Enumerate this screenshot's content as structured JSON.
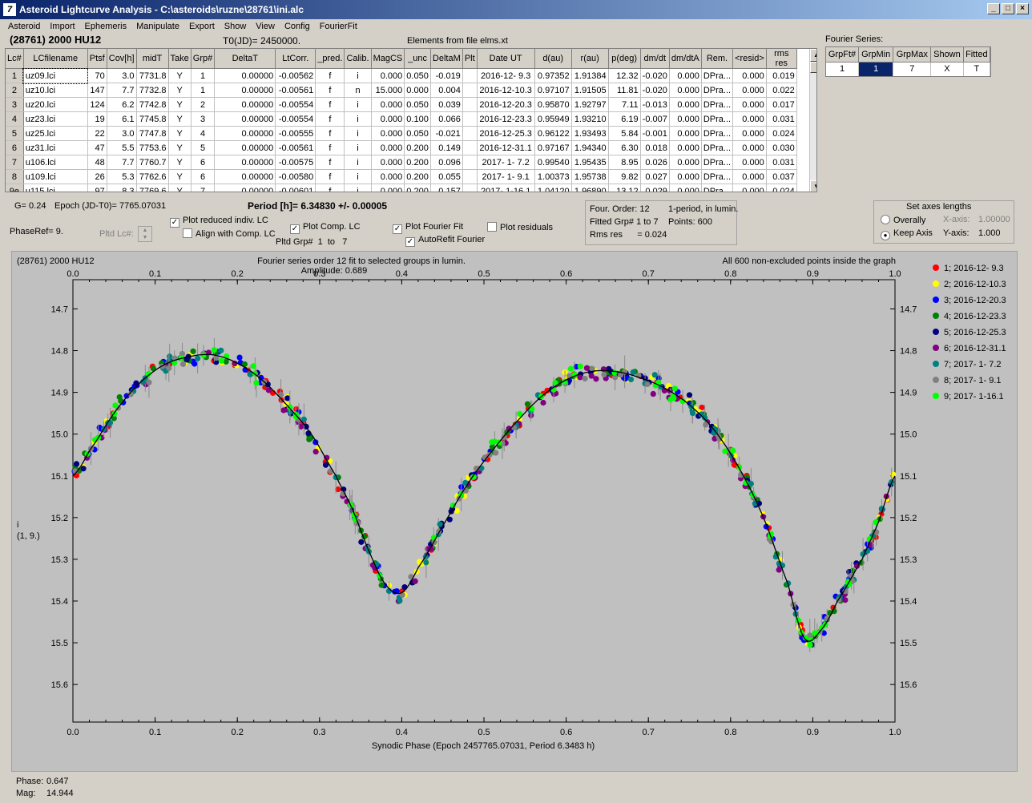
{
  "window": {
    "title": "Asteroid Lightcurve Analysis - C:\\asteroids\\ruzne\\28761\\ini.alc",
    "icon": "app-icon"
  },
  "menu": [
    "Asteroid",
    "Import",
    "Ephemeris",
    "Manipulate",
    "Export",
    "Show",
    "View",
    "Config",
    "FourierFit"
  ],
  "header": {
    "object": "(28761) 2000 HU12",
    "t0": "T0(JD)= 2450000.",
    "elements": "Elements from file elms.xt",
    "fourier_label": "Fourier Series:"
  },
  "table": {
    "columns": [
      "Lc#",
      "LCfilename",
      "Ptsf",
      "Cov[h]",
      "midT",
      "Take",
      "Grp#",
      "DeltaT",
      "LtCorr.",
      "_pred.",
      "Calib.",
      "MagCS",
      "_unc",
      "DeltaM",
      "Plt",
      "Date UT",
      "d(au)",
      "r(au)",
      "p(deg)",
      "dm/dt",
      "dm/dtA",
      "Rem.",
      "<resid>",
      "rms res"
    ],
    "rows": [
      [
        "1",
        "uz09.lci",
        "70",
        "3.0",
        "7731.8",
        "Y",
        "1",
        "0.00000",
        "-0.00562",
        "f",
        "i",
        "0.000",
        "0.050",
        "-0.019",
        "",
        "2016-12- 9.3",
        "0.97352",
        "1.91384",
        "12.32",
        "-0.020",
        "0.000",
        "DPra...",
        "0.000",
        "0.019"
      ],
      [
        "2",
        "uz10.lci",
        "147",
        "7.7",
        "7732.8",
        "Y",
        "1",
        "0.00000",
        "-0.00561",
        "f",
        "n",
        "15.000",
        "0.000",
        "0.004",
        "",
        "2016-12-10.3",
        "0.97107",
        "1.91505",
        "11.81",
        "-0.020",
        "0.000",
        "DPra...",
        "0.000",
        "0.022"
      ],
      [
        "3",
        "uz20.lci",
        "124",
        "6.2",
        "7742.8",
        "Y",
        "2",
        "0.00000",
        "-0.00554",
        "f",
        "i",
        "0.000",
        "0.050",
        "0.039",
        "",
        "2016-12-20.3",
        "0.95870",
        "1.92797",
        "7.11",
        "-0.013",
        "0.000",
        "DPra...",
        "0.000",
        "0.017"
      ],
      [
        "4",
        "uz23.lci",
        "19",
        "6.1",
        "7745.8",
        "Y",
        "3",
        "0.00000",
        "-0.00554",
        "f",
        "i",
        "0.000",
        "0.100",
        "0.066",
        "",
        "2016-12-23.3",
        "0.95949",
        "1.93210",
        "6.19",
        "-0.007",
        "0.000",
        "DPra...",
        "0.000",
        "0.031"
      ],
      [
        "5",
        "uz25.lci",
        "22",
        "3.0",
        "7747.8",
        "Y",
        "4",
        "0.00000",
        "-0.00555",
        "f",
        "i",
        "0.000",
        "0.050",
        "-0.021",
        "",
        "2016-12-25.3",
        "0.96122",
        "1.93493",
        "5.84",
        "-0.001",
        "0.000",
        "DPra...",
        "0.000",
        "0.024"
      ],
      [
        "6",
        "uz31.lci",
        "47",
        "5.5",
        "7753.6",
        "Y",
        "5",
        "0.00000",
        "-0.00561",
        "f",
        "i",
        "0.000",
        "0.200",
        "0.149",
        "",
        "2016-12-31.1",
        "0.97167",
        "1.94340",
        "6.30",
        "0.018",
        "0.000",
        "DPra...",
        "0.000",
        "0.030"
      ],
      [
        "7",
        "u106.lci",
        "48",
        "7.7",
        "7760.7",
        "Y",
        "6",
        "0.00000",
        "-0.00575",
        "f",
        "i",
        "0.000",
        "0.200",
        "0.096",
        "",
        "2017- 1- 7.2",
        "0.99540",
        "1.95435",
        "8.95",
        "0.026",
        "0.000",
        "DPra...",
        "0.000",
        "0.031"
      ],
      [
        "8",
        "u109.lci",
        "26",
        "5.3",
        "7762.6",
        "Y",
        "6",
        "0.00000",
        "-0.00580",
        "f",
        "i",
        "0.000",
        "0.200",
        "0.055",
        "",
        "2017- 1- 9.1",
        "1.00373",
        "1.95738",
        "9.82",
        "0.027",
        "0.000",
        "DPra...",
        "0.000",
        "0.037"
      ],
      [
        "9e",
        "u115.lci",
        "97",
        "8.3",
        "7769.6",
        "Y",
        "7",
        "0.00000",
        "-0.00601",
        "f",
        "i",
        "0.000",
        "0.200",
        "0.157",
        "",
        "2017- 1-16.1",
        "1.04120",
        "1.96890",
        "13.12",
        "0.029",
        "0.000",
        "DPra...",
        "0.000",
        "0.024"
      ]
    ]
  },
  "fourier_table": {
    "columns": [
      "GrpFt#",
      "GrpMin",
      "GrpMax",
      "Shown",
      "Fitted"
    ],
    "row": [
      "1",
      "1",
      "7",
      "X",
      "T"
    ]
  },
  "info": {
    "g": "G= 0.24",
    "epoch": "Epoch (JD-T0)= 7765.07031",
    "period": "Period [h]= 6.34830 +/- 0.00005",
    "phaseref": "PhaseRef= 9.",
    "pltd_lc": "Pltd Lc#:",
    "pltd_grp": "Pltd Grp#",
    "grp_from": "1",
    "grp_to_word": "to",
    "grp_to": "7"
  },
  "checks": {
    "plot_reduced": "Plot reduced indiv. LC",
    "align": "Align with Comp. LC",
    "plot_comp": "Plot Comp. LC",
    "plot_fourier": "Plot Fourier Fit",
    "autorefit": "AutoRefit Fourier",
    "plot_resid": "Plot residuals"
  },
  "fourier_info": {
    "order": "Four. Order: 12",
    "mode": "1-period, in lumin.",
    "fitted": "Fitted Grp# 1 to 7",
    "points": "Points: 600",
    "rms": "Rms res      = 0.024"
  },
  "axes": {
    "title": "Set axes lengths",
    "overally": "Overally",
    "keep": "Keep Axis",
    "xaxis_label": "X-axis:",
    "xaxis_val": "1.00000",
    "yaxis_label": "Y-axis:",
    "yaxis_val": "1.000"
  },
  "status": {
    "phase_label": "Phase:",
    "phase": "0.647",
    "mag_label": "Mag:",
    "mag": "14.944"
  },
  "chart_data": {
    "type": "scatter",
    "title_left": "(28761) 2000 HU12",
    "title_center": "Fourier series order 12 fit to selected groups in lumin.",
    "amplitude": "Amplitude: 0.689",
    "title_right": "All 600 non-excluded points inside the graph",
    "xlabel": "Synodic Phase (Epoch 2457765.07031, Period 6.3483 h)",
    "ylabel": [
      "i",
      "(1, 9.)"
    ],
    "xlim": [
      0,
      1
    ],
    "ylim": [
      14.63,
      15.69
    ],
    "y_inverted": true,
    "xticks": [
      "0.0",
      "0.1",
      "0.2",
      "0.3",
      "0.4",
      "0.5",
      "0.6",
      "0.7",
      "0.8",
      "0.9",
      "1.0"
    ],
    "yticks": [
      "14.7",
      "14.8",
      "14.9",
      "15.0",
      "15.1",
      "15.2",
      "15.3",
      "15.4",
      "15.5",
      "15.6"
    ],
    "fit_curve": [
      [
        0.0,
        15.1
      ],
      [
        0.02,
        15.04
      ],
      [
        0.05,
        14.95
      ],
      [
        0.08,
        14.88
      ],
      [
        0.11,
        14.835
      ],
      [
        0.14,
        14.815
      ],
      [
        0.17,
        14.81
      ],
      [
        0.2,
        14.83
      ],
      [
        0.23,
        14.87
      ],
      [
        0.26,
        14.93
      ],
      [
        0.29,
        15.0
      ],
      [
        0.32,
        15.1
      ],
      [
        0.34,
        15.18
      ],
      [
        0.36,
        15.28
      ],
      [
        0.38,
        15.36
      ],
      [
        0.4,
        15.38
      ],
      [
        0.42,
        15.32
      ],
      [
        0.45,
        15.22
      ],
      [
        0.48,
        15.12
      ],
      [
        0.51,
        15.04
      ],
      [
        0.54,
        14.97
      ],
      [
        0.57,
        14.91
      ],
      [
        0.6,
        14.87
      ],
      [
        0.63,
        14.85
      ],
      [
        0.66,
        14.85
      ],
      [
        0.69,
        14.865
      ],
      [
        0.72,
        14.89
      ],
      [
        0.75,
        14.93
      ],
      [
        0.78,
        14.99
      ],
      [
        0.81,
        15.08
      ],
      [
        0.84,
        15.2
      ],
      [
        0.87,
        15.36
      ],
      [
        0.89,
        15.49
      ],
      [
        0.91,
        15.47
      ],
      [
        0.93,
        15.4
      ],
      [
        0.96,
        15.3
      ],
      [
        0.98,
        15.21
      ],
      [
        1.0,
        15.1
      ]
    ],
    "series": [
      {
        "name": "1; 2016-12- 9.3",
        "color": "#ff0000"
      },
      {
        "name": "2; 2016-12-10.3",
        "color": "#ffff00"
      },
      {
        "name": "3; 2016-12-20.3",
        "color": "#0000ff"
      },
      {
        "name": "4; 2016-12-23.3",
        "color": "#008000"
      },
      {
        "name": "5; 2016-12-25.3",
        "color": "#000080"
      },
      {
        "name": "6; 2016-12-31.1",
        "color": "#800080"
      },
      {
        "name": "7; 2017- 1- 7.2",
        "color": "#008080"
      },
      {
        "name": "8; 2017- 1- 9.1",
        "color": "#808080"
      },
      {
        "name": "9; 2017- 1-16.1",
        "color": "#00ff00"
      }
    ],
    "points_total": 600
  }
}
